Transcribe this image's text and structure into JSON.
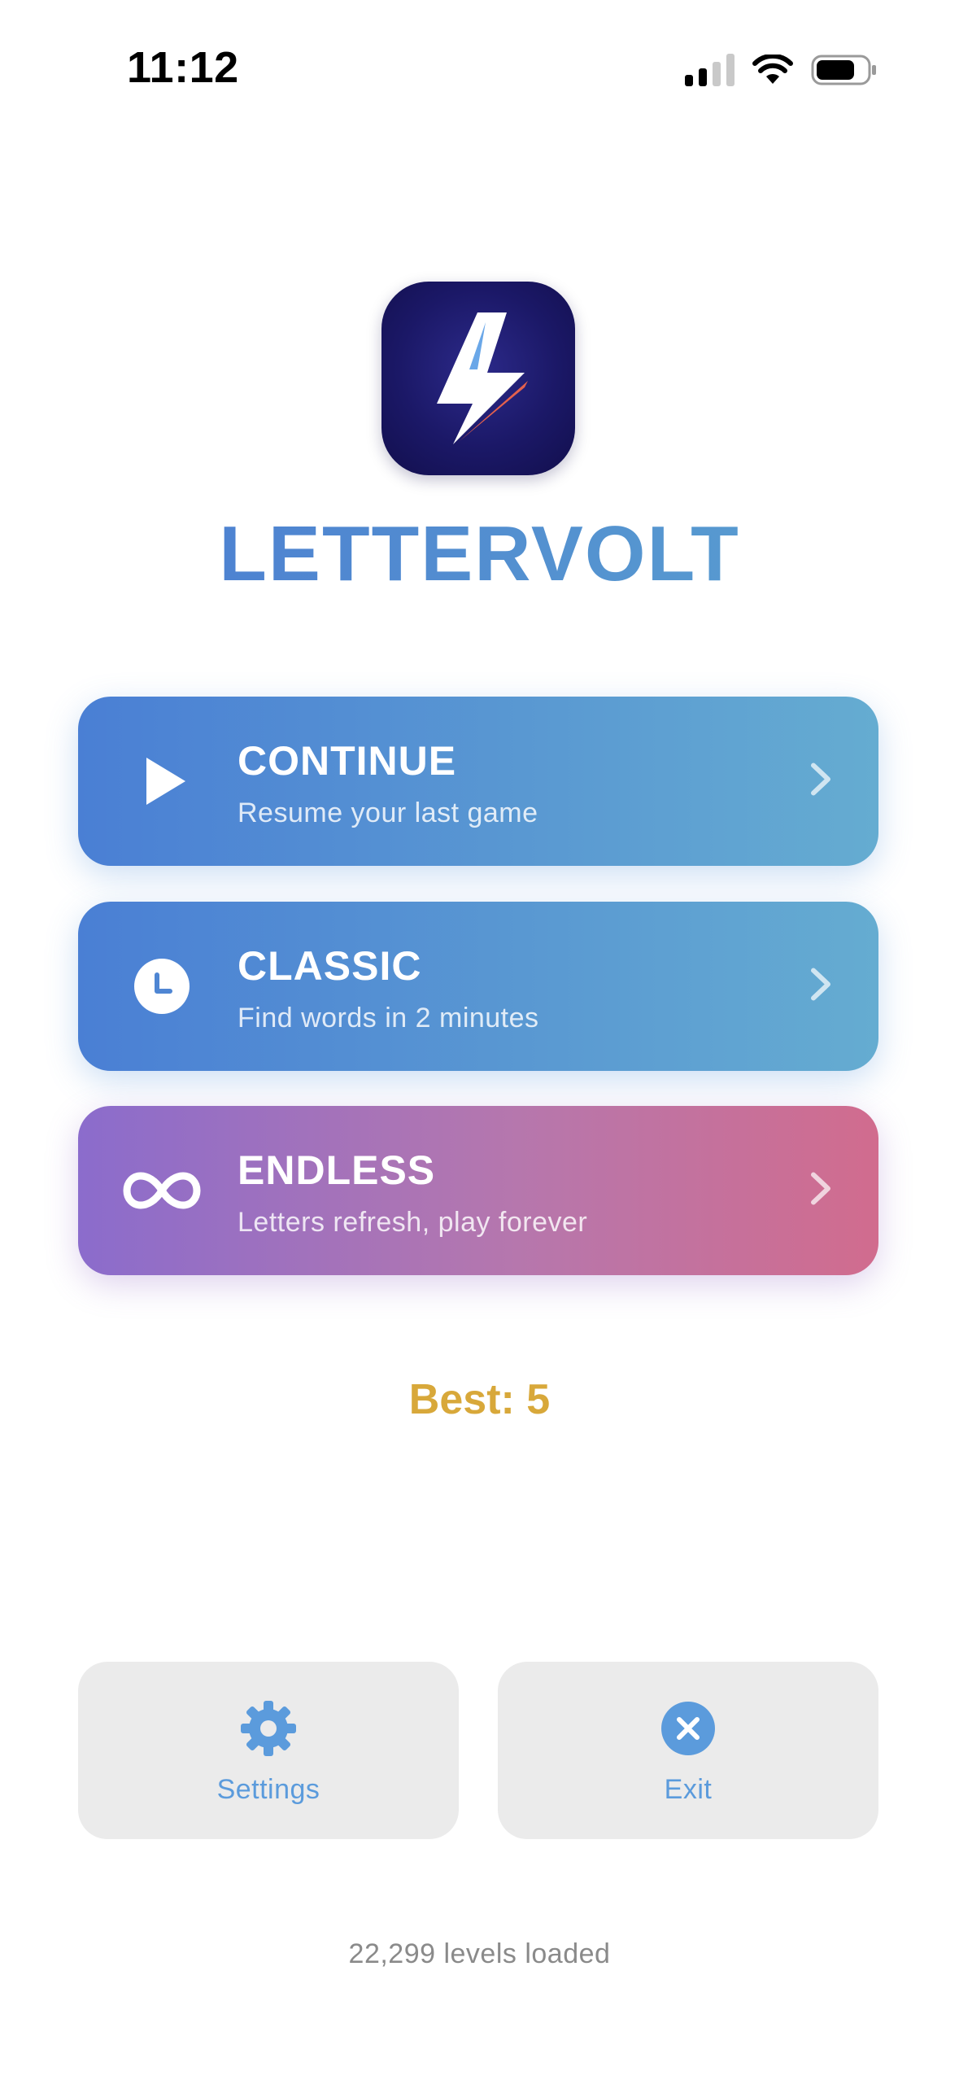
{
  "status_bar": {
    "time": "11:12",
    "icons": [
      "cellular-signal-icon",
      "wifi-icon",
      "battery-icon"
    ]
  },
  "brand": {
    "app_icon": "lightning-bolt-icon",
    "name": "LETTERVOLT"
  },
  "modes": [
    {
      "title": "CONTINUE",
      "subtitle": "Resume your last game",
      "icon": "play-icon"
    },
    {
      "title": "CLASSIC",
      "subtitle": "Find words in 2 minutes",
      "icon": "clock-icon"
    },
    {
      "title": "ENDLESS",
      "subtitle": "Letters refresh, play forever",
      "icon": "infinity-icon"
    }
  ],
  "best_score": "Best: 5",
  "actions": {
    "settings_label": "Settings",
    "exit_label": "Exit"
  },
  "footer": "22,299 levels loaded",
  "colors": {
    "brand_gradient_start": "#4a79d1",
    "brand_gradient_end": "#5ba3d0",
    "blue_card_start": "#4a7fd4",
    "blue_card_end": "#65acd1",
    "purple_card_start": "#8b6ccc",
    "pink_card_end": "#d16c8e",
    "best_score": "#d8a83a",
    "action_label": "#5b9bdc",
    "icon_bg": "#1b1867"
  }
}
